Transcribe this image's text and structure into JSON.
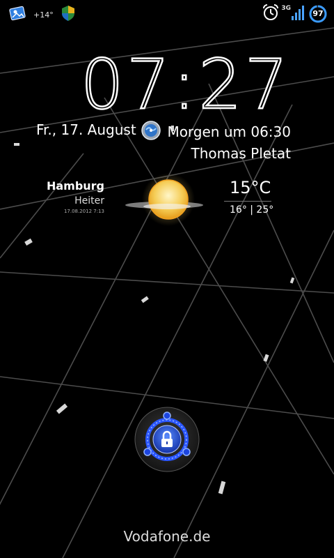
{
  "status_bar": {
    "left_icons": [
      "photo-icon",
      "weather-notification-icon",
      "shield-icon"
    ],
    "temperature": "+14°",
    "right_icons": [
      "alarm-clock-icon",
      "signal-bars-icon",
      "battery-icon"
    ],
    "network_type": "3G",
    "battery_level": "97"
  },
  "lockscreen": {
    "time": "07:27",
    "date": "Fr., 17. August",
    "alarm_icon": "alarm-globe-icon",
    "alarm_text": "Morgen um 06:30",
    "owner": "Thomas Pletat"
  },
  "weather": {
    "city": "Hamburg",
    "condition": "Heiter",
    "updated": "17.08.2012 7:13",
    "icon": "sun-icon",
    "temperature": "15°C",
    "range": "16° | 25°"
  },
  "unlock": {
    "icon": "lock-icon"
  },
  "footer": {
    "carrier": "Vodafone.de"
  }
}
